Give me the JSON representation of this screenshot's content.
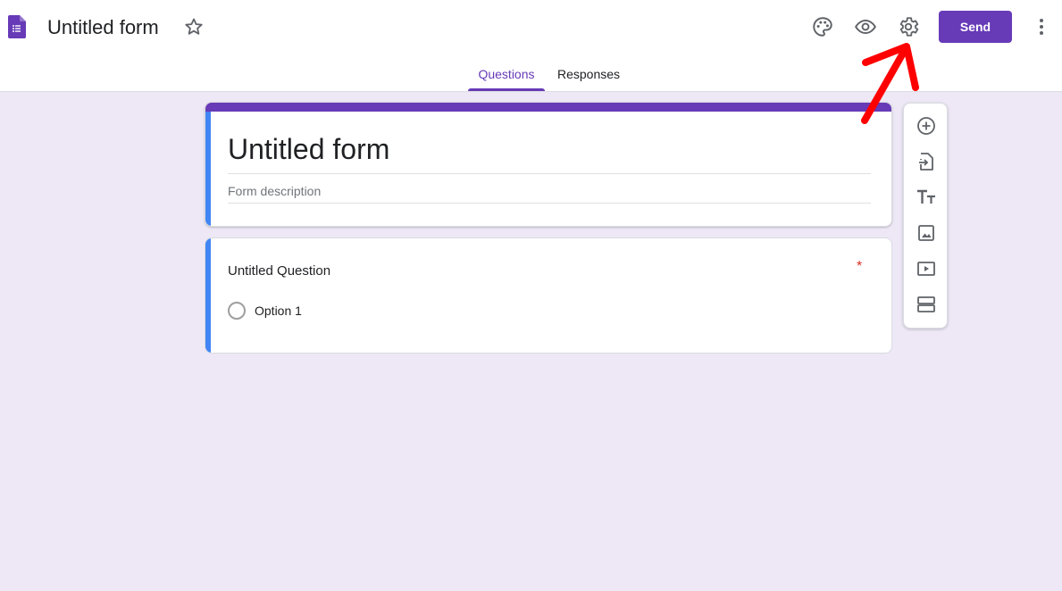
{
  "header": {
    "title": "Untitled form",
    "icons": [
      "forms-logo-icon",
      "star-icon",
      "palette-icon",
      "eye-icon",
      "gear-icon",
      "more-vert-icon"
    ],
    "send_label": "Send"
  },
  "tabs": [
    {
      "label": "Questions",
      "active": true
    },
    {
      "label": "Responses",
      "active": false
    }
  ],
  "form": {
    "title": "Untitled form",
    "description_placeholder": "Form description"
  },
  "question": {
    "title": "Untitled Question",
    "required_mark": "*",
    "options": [
      "Option 1"
    ]
  },
  "toolbar": {
    "icons": [
      "add-circle-icon",
      "import-icon",
      "title-text-icon",
      "image-icon",
      "video-icon",
      "section-icon"
    ]
  },
  "colors": {
    "accent": "#673ab7",
    "background": "#ede7f6",
    "focus_bar": "#4285f4",
    "annotation": "#ff0000"
  }
}
